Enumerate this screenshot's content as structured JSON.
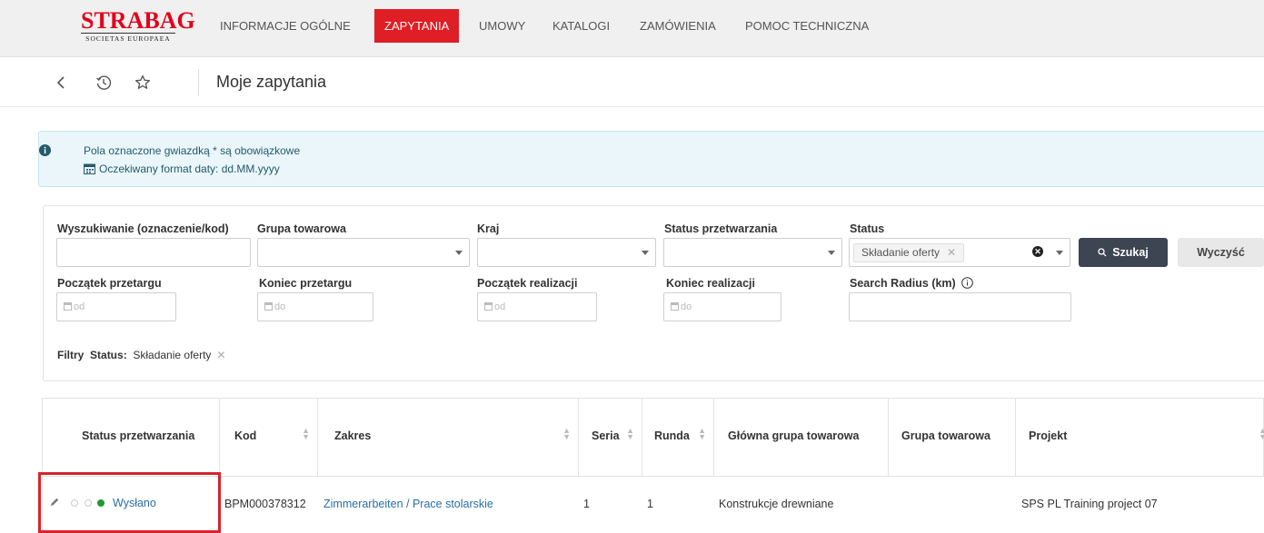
{
  "brand": {
    "name": "STRABAG",
    "tagline": "SOCIETAS EUROPAEA",
    "color": "#e2001a"
  },
  "nav": {
    "items": [
      {
        "label": "INFORMACJE OGÓLNE",
        "active": false
      },
      {
        "label": "ZAPYTANIA",
        "active": true
      },
      {
        "label": "UMOWY",
        "active": false
      },
      {
        "label": "KATALOGI",
        "active": false
      },
      {
        "label": "ZAMÓWIENIA",
        "active": false
      },
      {
        "label": "POMOC TECHNICZNA",
        "active": false
      }
    ],
    "active_color": "#e01e25"
  },
  "toolbar": {
    "icons": [
      "chevron-left-icon",
      "history-icon",
      "star-icon"
    ],
    "title": "Moje zapytania"
  },
  "info": {
    "required_note": "Pola oznaczone gwiazdką * są obowiązkowe",
    "date_format_note": "Oczekiwany format daty: dd.MM.yyyy"
  },
  "filters": {
    "search_label": "Wyszukiwanie (oznaczenie/kod)",
    "product_group_label": "Grupa towarowa",
    "country_label": "Kraj",
    "processing_status_label": "Status przetwarzania",
    "status_label": "Status",
    "status_value": "Składanie oferty",
    "search_button": "Szukaj",
    "clear_button": "Wyczyść",
    "tender_start_label": "Początek przetargu",
    "tender_end_label": "Koniec przetargu",
    "realization_start_label": "Początek realizacji",
    "realization_end_label": "Koniec realizacji",
    "radius_label": "Search Radius (km)",
    "from_placeholder": "od",
    "to_placeholder": "do",
    "active_filters_label": "Filtry",
    "active_filter_key": "Status:",
    "active_filter_value": "Składanie oferty"
  },
  "table": {
    "headers": [
      "Status przetwarzania",
      "Kod",
      "Zakres",
      "Seria",
      "Runda",
      "Główna grupa towarowa",
      "Grupa towarowa",
      "Projekt"
    ],
    "rows": [
      {
        "status": "Wysłano",
        "code": "BPM000378312",
        "scope": "Zimmerarbeiten / Prace stolarskie",
        "series": "1",
        "round": "1",
        "main_group": "Konstrukcje drewniane",
        "group": "",
        "project": "SPS PL Training project 07"
      }
    ],
    "status_dot_color": "#1f9a2e"
  }
}
